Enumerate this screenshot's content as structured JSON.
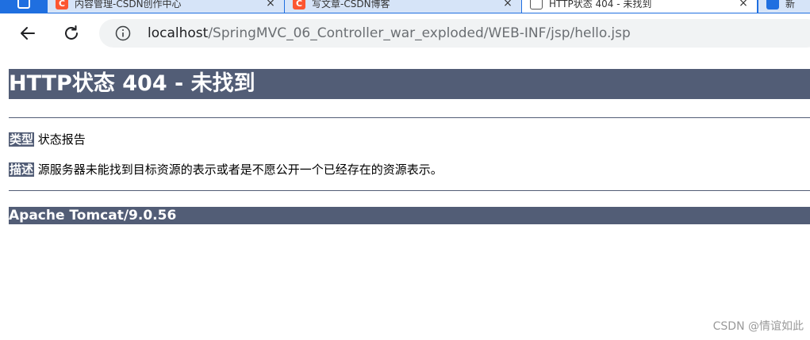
{
  "browser": {
    "tabs": [
      {
        "title": "内容管理-CSDN创作中心",
        "favicon": "csdn-icon",
        "active": false
      },
      {
        "title": "写文章-CSDN博客",
        "favicon": "csdn-icon",
        "active": false
      },
      {
        "title": "HTTP状态 404 - 未找到",
        "favicon": "page-icon",
        "active": true
      },
      {
        "title": "新",
        "favicon": "edge-icon",
        "active": false
      }
    ],
    "close_glyph": "×",
    "address": {
      "host": "localhost",
      "path": "/SpringMVC_06_Controller_war_exploded/WEB-INF/jsp/hello.jsp"
    },
    "colors": {
      "tabbar": "#1f6fe0",
      "csdn": "#fc5531"
    }
  },
  "page": {
    "heading": "HTTP状态 404 - 未找到",
    "type_label": "类型",
    "type_value": "状态报告",
    "desc_label": "描述",
    "desc_value": "源服务器未能找到目标资源的表示或者是不愿公开一个已经存在的资源表示。",
    "footer": "Apache Tomcat/9.0.56",
    "accent_color": "#525d76"
  },
  "watermark": "CSDN @情谊如此"
}
